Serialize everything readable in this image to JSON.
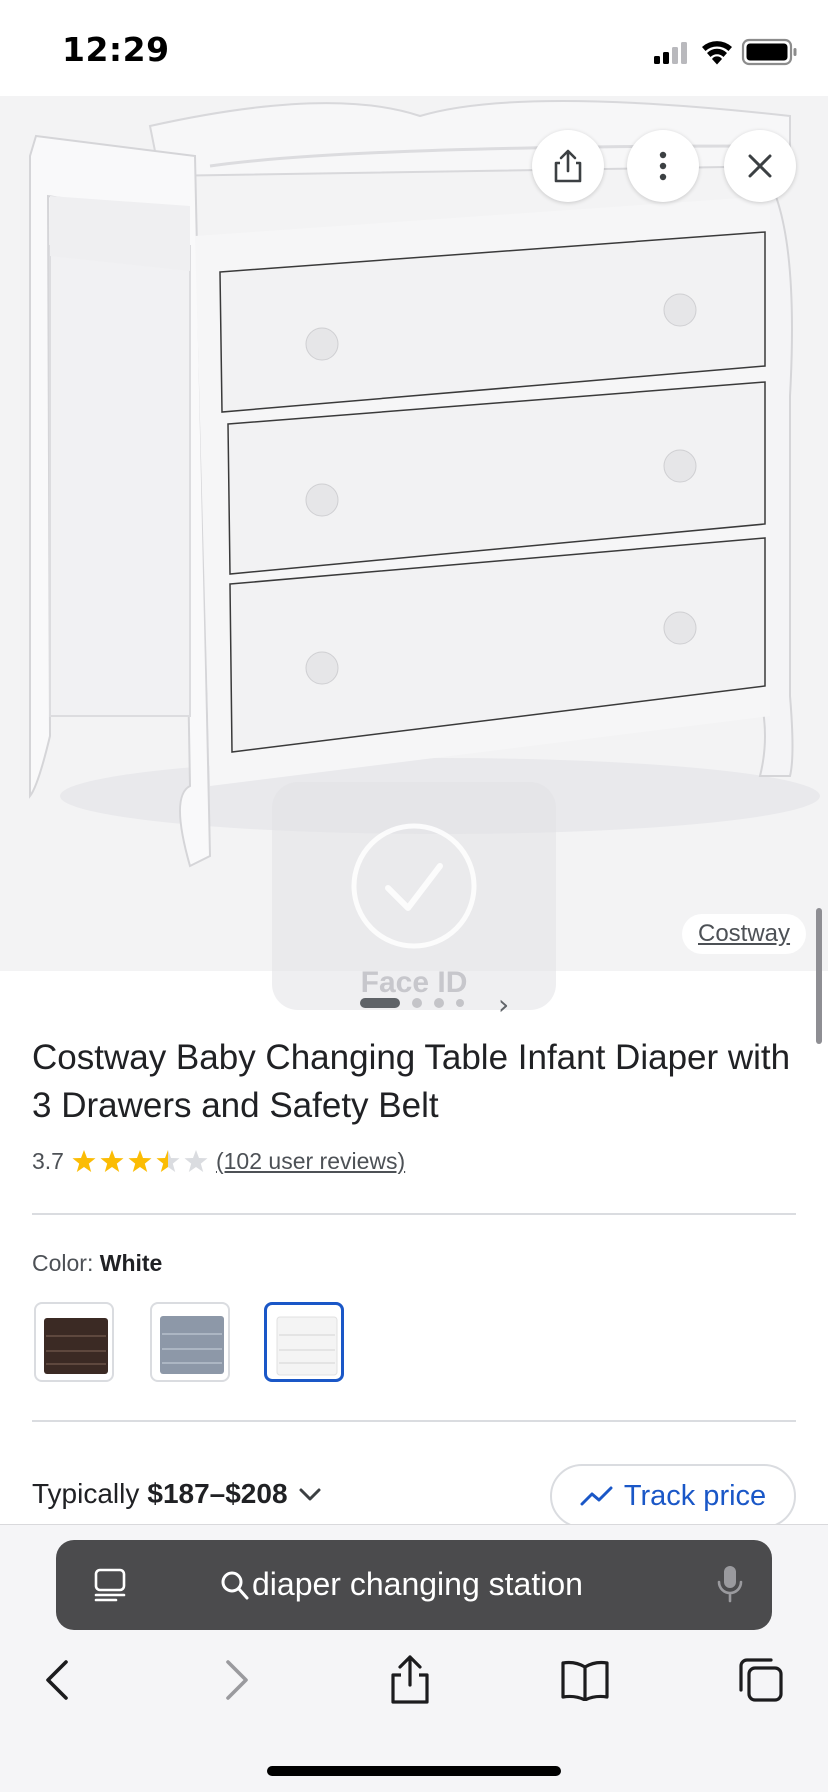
{
  "status_bar": {
    "time": "12:29",
    "icons": [
      "signal-icon",
      "wifi-icon",
      "battery-icon"
    ]
  },
  "hero": {
    "image_alt": "white changing table dresser with 3 drawers",
    "buttons": [
      "share-icon",
      "more-vert-icon",
      "close-icon"
    ],
    "brand_chip": "Costway",
    "face_id_label": "Face ID",
    "carousel": {
      "count": 4,
      "active": 0
    }
  },
  "product": {
    "title": "Costway Baby Changing Table Infant Diaper with 3 Drawers and Safety Belt",
    "rating": "3.7",
    "rating_value": 3.7,
    "rating_max": 5,
    "reviews": "(102 user reviews)"
  },
  "color": {
    "label": "Color:",
    "value": "White",
    "options": [
      {
        "name": "espresso",
        "color": "#3b2a24"
      },
      {
        "name": "gray",
        "color": "#8d98a8"
      },
      {
        "name": "white",
        "color": "#f4f4f4",
        "selected": true
      }
    ]
  },
  "price": {
    "label": "Typically",
    "range": "$187–$208",
    "track_label": "Track price"
  },
  "browser": {
    "url_text": "diaper changing station",
    "toolbar_icons": [
      "back-icon",
      "forward-icon",
      "share-icon",
      "bookmarks-icon",
      "tabs-icon"
    ]
  },
  "colors": {
    "accent": "#1a57c7",
    "star": "#fbbc04",
    "urlbar_bg": "#4b4b4d"
  }
}
